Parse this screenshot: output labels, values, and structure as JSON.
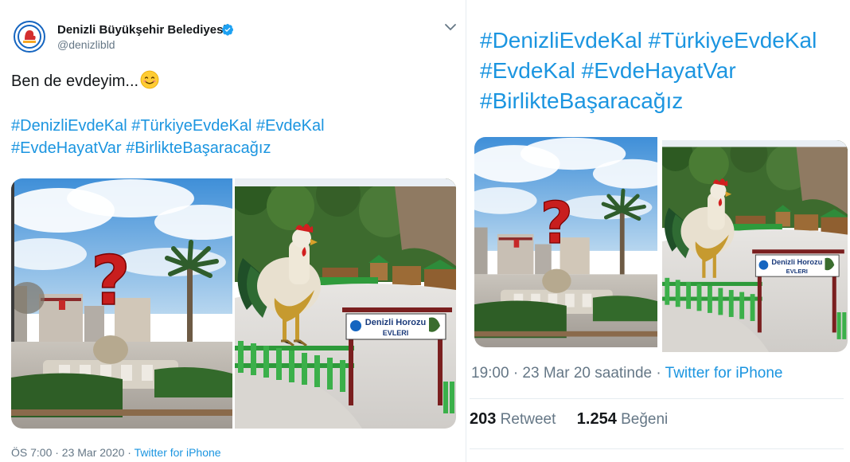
{
  "tweet": {
    "account_name": "Denizli Büyükşehir Belediyesi",
    "handle": "@denizlibld",
    "text": "Ben de evdeyim...",
    "hashtags": [
      "#DenizliEvdeKal",
      "#TürkiyeEvdeKal",
      "#EvdeKal",
      "#EvdeHayatVar",
      "#BirlikteBaşaracağız"
    ],
    "timestamp": "ÖS 7:00 · 23 Mar 2020",
    "source": "Twitter for iPhone"
  },
  "images": {
    "sign_title": "Denizli Horozu",
    "sign_subtitle": "EVLERI",
    "question_mark": "?"
  },
  "detail": {
    "hashtags": [
      "#DenizliEvdeKal",
      "#TürkiyeEvdeKal",
      "#EvdeKal",
      "#EvdeHayatVar",
      "#BirlikteBaşaracağız"
    ],
    "timestamp": "19:00 · 23 Mar 20 saatinde · ",
    "source": "Twitter for iPhone",
    "retweets_count": "203",
    "retweets_label": "Retweet",
    "likes_count": "1.254",
    "likes_label": "Beğeni"
  },
  "colors": {
    "link": "#1b95e0",
    "muted": "#657786",
    "verified": "#1da1f2"
  },
  "icons": [
    "verified-badge-icon",
    "chevron-down-icon",
    "smiling-face-emoji",
    "city-logo"
  ]
}
